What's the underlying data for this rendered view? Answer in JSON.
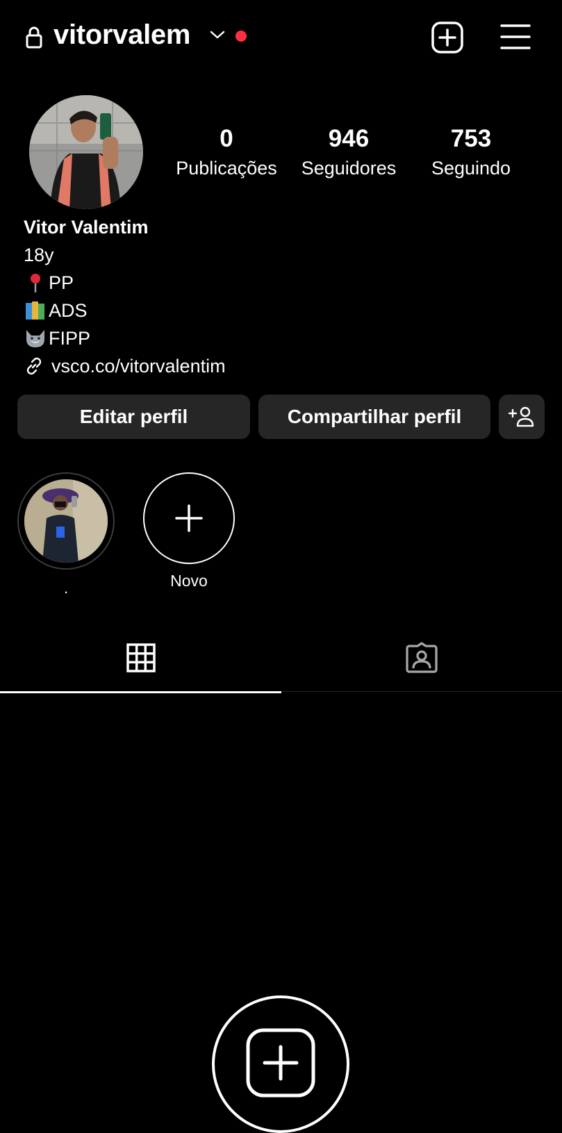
{
  "header": {
    "username": "vitorvalem",
    "icons": [
      "lock-icon",
      "chevron-down-icon",
      "notification-dot",
      "new-post-icon",
      "menu-icon"
    ],
    "dot_color": "#ff3040"
  },
  "stats": [
    {
      "value": "0",
      "label": "Publicações"
    },
    {
      "value": "946",
      "label": "Seguidores"
    },
    {
      "value": "753",
      "label": "Seguindo"
    }
  ],
  "bio": {
    "name": "Vitor Valentim",
    "lines": [
      "18y",
      "PP",
      "ADS",
      "FIPP"
    ],
    "line_icons": [
      "pin-icon",
      "books-icon",
      "wolf-icon"
    ],
    "link": "vsco.co/vitorvalentim"
  },
  "buttons": {
    "edit": "Editar perfil",
    "share": "Compartilhar perfil"
  },
  "highlights": [
    {
      "label": "."
    },
    {
      "label": "Novo"
    }
  ],
  "tabs": [
    "grid-icon",
    "tagged-icon"
  ],
  "colors": {
    "background": "#000000",
    "button": "#262626",
    "text": "#ffffff"
  }
}
